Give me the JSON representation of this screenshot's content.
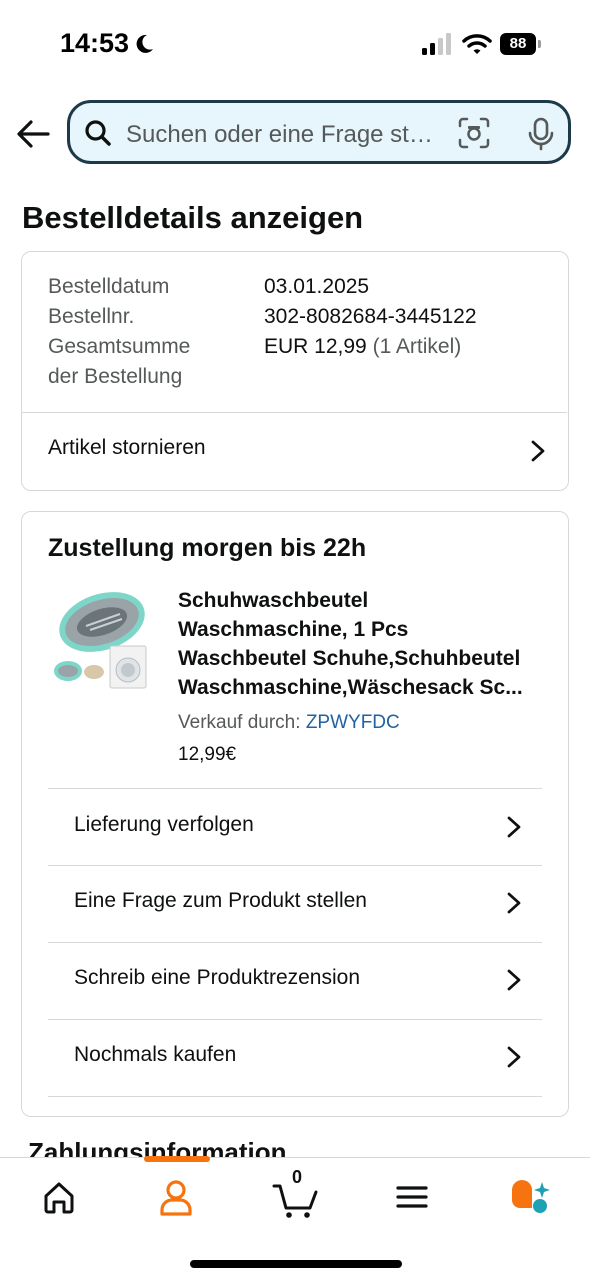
{
  "status_bar": {
    "time": "14:53",
    "battery": "88"
  },
  "search": {
    "placeholder": "Suchen oder eine Frage stellen"
  },
  "page": {
    "title": "Bestelldetails anzeigen"
  },
  "order_summary": {
    "rows": [
      {
        "label": "Bestelldatum",
        "value": "03.01.2025"
      },
      {
        "label": "Bestellnr.",
        "value": "302-8082684-3445122"
      },
      {
        "label_line1": "Gesamtsumme",
        "label_line2": "der Bestellung",
        "value": "EUR 12,99",
        "value_note": "(1 Artikel)"
      }
    ],
    "cancel_link": "Artikel stornieren"
  },
  "delivery": {
    "heading": "Zustellung morgen bis 22h",
    "product": {
      "title_lines": [
        "Schuhwaschbeutel",
        "Waschmaschine, 1 Pcs",
        "Waschbeutel Schuhe,Schuhbeutel",
        "Waschmaschine,Wäschesack Sc..."
      ],
      "sold_by_label": "Verkauf durch:",
      "seller": "ZPWYFDC",
      "price": "12,99€"
    },
    "actions": [
      "Lieferung verfolgen",
      "Eine Frage zum Produkt stellen",
      "Schreib eine Produktrezension",
      "Nochmals kaufen"
    ]
  },
  "payment": {
    "heading": "Zahlungsinformation"
  },
  "nav": {
    "cart_count": "0"
  },
  "colors": {
    "accent": "#f7730f",
    "link": "#2162a1",
    "search_bg": "#e6f6fc",
    "search_border": "#1c3a4a"
  }
}
